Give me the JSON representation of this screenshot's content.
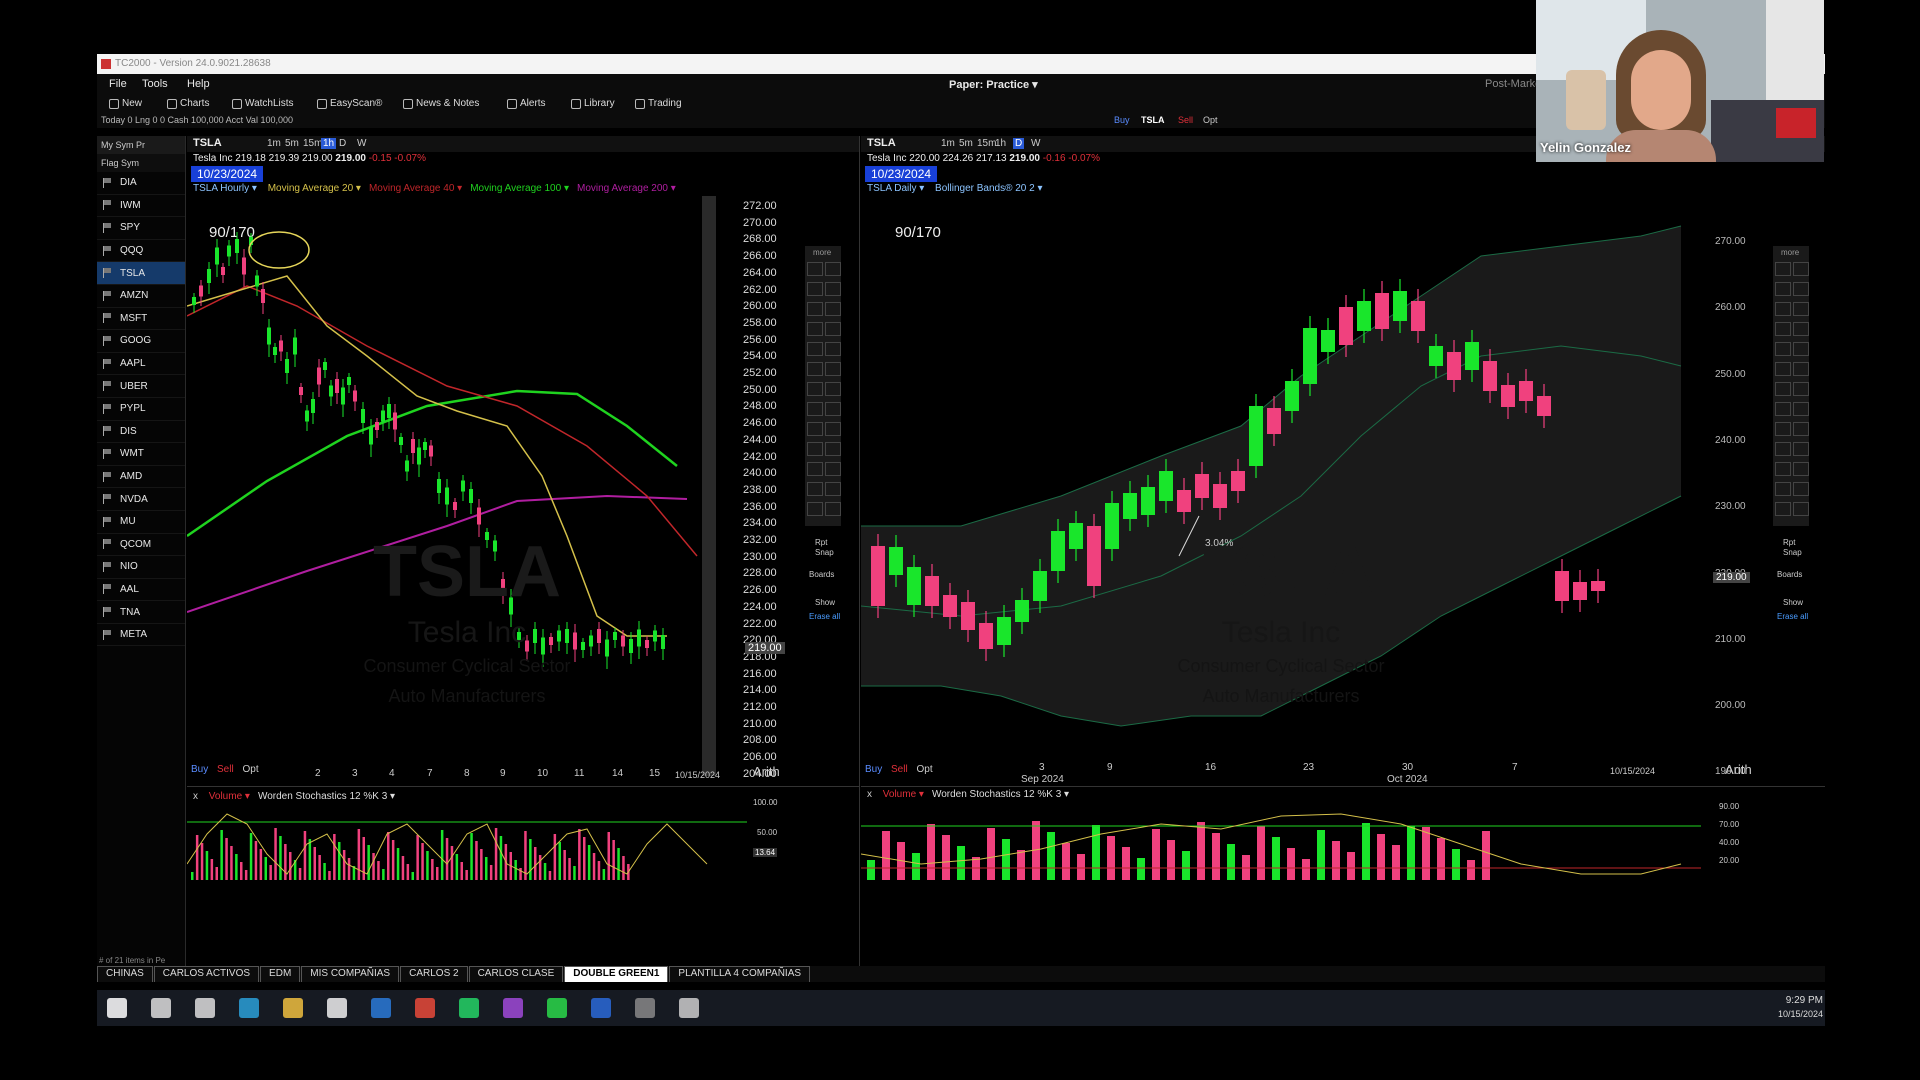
{
  "window": {
    "title": "TC2000 - Version 24.0.9021.28638"
  },
  "menu": {
    "file": "File",
    "tools": "Tools",
    "help": "Help",
    "paper": "Paper: Practice ▾",
    "post_market": "Post-Marke"
  },
  "toolbar": {
    "new": "New",
    "charts": "Charts",
    "watchlists": "WatchLists",
    "easyscan": "EasyScan®",
    "news": "News & Notes",
    "alerts": "Alerts",
    "library": "Library",
    "trading": "Trading"
  },
  "account": {
    "line": "Today 0   Lng 0 0   Cash 100,000   Acct Val 100,000"
  },
  "trade_buttons": {
    "buy": "Buy",
    "sym": "TSLA",
    "sell": "Sell",
    "opt": "Opt"
  },
  "watchlist": {
    "header": "My  Sym  Pr",
    "subheader": "Flag  Sym",
    "symbols": [
      "DIA",
      "IWM",
      "SPY",
      "QQQ",
      "TSLA",
      "AMZN",
      "MSFT",
      "GOOG",
      "AAPL",
      "UBER",
      "PYPL",
      "DIS",
      "WMT",
      "AMD",
      "NVDA",
      "MU",
      "QCOM",
      "NIO",
      "AAL",
      "TNA",
      "META"
    ],
    "selected": "TSLA",
    "footer": "# of 21 items in Pe"
  },
  "left_chart": {
    "symbol": "TSLA",
    "timeframes": [
      "1m",
      "5m",
      "15m",
      "1h",
      "D",
      "W"
    ],
    "active_tf": "1h",
    "quote_name": "Tesla Inc",
    "quote_values": "219.18  219.39  219.00",
    "last": "219.00",
    "change": "-0.15  -0.07%",
    "date": "10/23/2024",
    "study_title": "TSLA Hourly ▾",
    "studies": [
      "Moving Average 20 ▾",
      "Moving Average 40 ▾",
      "Moving Average 100 ▾",
      "Moving Average 200 ▾"
    ],
    "ratio": "90/170",
    "y_ticks": [
      "272.00",
      "270.00",
      "268.00",
      "266.00",
      "264.00",
      "262.00",
      "260.00",
      "258.00",
      "256.00",
      "254.00",
      "252.00",
      "250.00",
      "248.00",
      "246.00",
      "244.00",
      "242.00",
      "240.00",
      "238.00",
      "236.00",
      "234.00",
      "232.00",
      "230.00",
      "228.00",
      "226.00",
      "224.00",
      "222.00",
      "220.00",
      "218.00",
      "216.00",
      "214.00",
      "212.00",
      "210.00",
      "208.00",
      "206.00",
      "204.00"
    ],
    "price_flag": "219.00",
    "x_ticks": [
      "2",
      "3",
      "4",
      "7",
      "8",
      "9",
      "10",
      "11",
      "14",
      "15"
    ],
    "x_date": "10/15/2024",
    "scale": "Arith",
    "watermark": {
      "sym": "TSLA",
      "name": "Tesla Inc",
      "sector": "Consumer Cyclical Sector",
      "industry": "Auto Manufacturers"
    },
    "lower_pane": {
      "studies": [
        "Volume ▾",
        "Worden Stochastics 12 %K 3 ▾"
      ],
      "ticks": [
        "100.00",
        "50.00"
      ],
      "flag": "13.64"
    }
  },
  "right_chart": {
    "symbol": "TSLA",
    "timeframes": [
      "1m",
      "5m",
      "15m",
      "1h",
      "D",
      "W"
    ],
    "active_tf": "D",
    "quote_name": "Tesla Inc",
    "quote_values": "220.00  224.26  217.13",
    "last": "219.00",
    "change": "-0.16  -0.07%",
    "date": "10/23/2024",
    "study_title": "TSLA Daily ▾",
    "studies": [
      "Bollinger Bands® 20 2 ▾"
    ],
    "ratio": "90/170",
    "y_ticks": [
      "270.00",
      "260.00",
      "250.00",
      "240.00",
      "230.00",
      "220.00",
      "210.00",
      "200.00",
      "190.00"
    ],
    "price_flag": "219.00",
    "annotation": "3.04%",
    "x_ticks": [
      "3",
      "9",
      "16",
      "23",
      "30",
      "7"
    ],
    "x_months": [
      "Sep 2024",
      "Oct 2024"
    ],
    "x_date": "10/15/2024",
    "scale": "Arith",
    "watermark": {
      "sym": "TSLA",
      "name": "Tesla Inc",
      "sector": "Consumer Cyclical Sector",
      "industry": "Auto Manufacturers"
    },
    "lower_pane": {
      "studies": [
        "Volume ▾",
        "Worden Stochastics 12 %K 3 ▾"
      ],
      "ticks": [
        "90.00",
        "70.00",
        "40.00",
        "20.00"
      ]
    }
  },
  "panel_footer": {
    "buy": "Buy",
    "sell": "Sell",
    "opt": "Opt"
  },
  "side_tools": {
    "more": "more",
    "rpt": "Rpt",
    "snap": "Snap",
    "boards": "Boards",
    "show": "Show",
    "erase": "Erase all"
  },
  "bottom_tabs": [
    "CHINAS",
    "CARLOS ACTIVOS",
    "EDM",
    "MIS COMPAÑIAS",
    "CARLOS 2",
    "CARLOS CLASE",
    "DOUBLE GREEN1",
    "PLANTILLA 4 COMPAÑIAS"
  ],
  "active_tab": "DOUBLE GREEN1",
  "webcam": {
    "name": "Yelin Gonzalez"
  },
  "clock": {
    "time": "9:29 PM",
    "date": "10/15/2024"
  },
  "colors": {
    "up": "#19e62b",
    "down": "#f0417e",
    "ma20": "#d4c04a",
    "ma40": "#c0262a",
    "ma100": "#1fd31f",
    "ma200": "#b01ea0",
    "date_bg": "#1840d8"
  }
}
